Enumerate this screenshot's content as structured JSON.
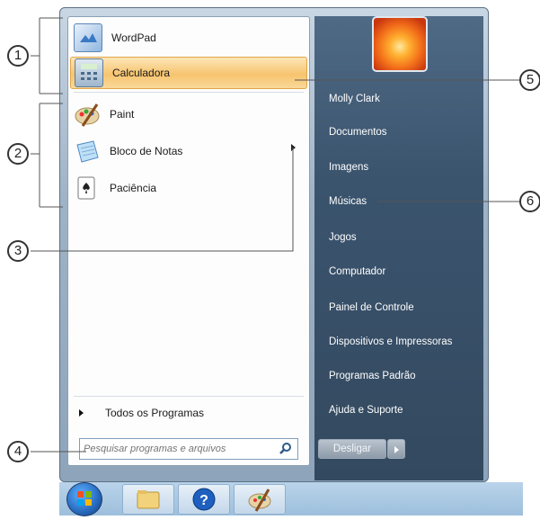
{
  "programs": [
    {
      "label": "WordPad",
      "icon": "wordpad-icon"
    },
    {
      "label": "Calculadora",
      "icon": "calculator-icon",
      "highlighted": true
    },
    {
      "label": "Paint",
      "icon": "paint-icon"
    },
    {
      "label": "Bloco de Notas",
      "icon": "notepad-icon"
    },
    {
      "label": "Paciência",
      "icon": "solitaire-icon"
    }
  ],
  "all_programs_label": "Todos os Programas",
  "search": {
    "placeholder": "Pesquisar programas e arquivos"
  },
  "right_panel": {
    "items": [
      {
        "label": "Molly Clark"
      },
      {
        "label": "Documentos"
      },
      {
        "label": "Imagens"
      },
      {
        "label": "Músicas"
      },
      {
        "label": "Jogos"
      },
      {
        "label": "Computador"
      },
      {
        "label": "Painel de Controle"
      },
      {
        "label": "Dispositivos e Impressoras"
      },
      {
        "label": "Programas Padrão"
      },
      {
        "label": "Ajuda e Suporte"
      }
    ]
  },
  "shutdown_label": "Desligar",
  "callouts": [
    "1",
    "2",
    "3",
    "4",
    "5",
    "6"
  ],
  "colors": {
    "highlight": "#f7c46f",
    "right_panel": "#3b546e",
    "taskbar": "#b9d3ea"
  }
}
